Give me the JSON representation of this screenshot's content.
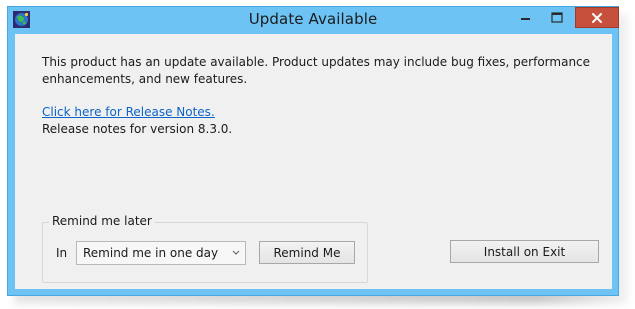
{
  "window": {
    "title": "Update Available",
    "icon": "app-globe-icon",
    "controls": [
      "minimize-icon",
      "maximize-icon",
      "close-icon"
    ],
    "accent_color": "#6cc3f4",
    "close_color": "#c7503c"
  },
  "body": {
    "message": "This product has an update available. Product updates may include bug fixes, performance enhancements, and new features.",
    "release_notes_link": "Click here for Release Notes.",
    "release_notes_version": "Release notes for version 8.3.0."
  },
  "remind": {
    "group_label": "Remind me later",
    "in_label": "In",
    "selected_option": "Remind me in one day",
    "button_label": "Remind Me"
  },
  "actions": {
    "install_label": "Install on Exit"
  }
}
